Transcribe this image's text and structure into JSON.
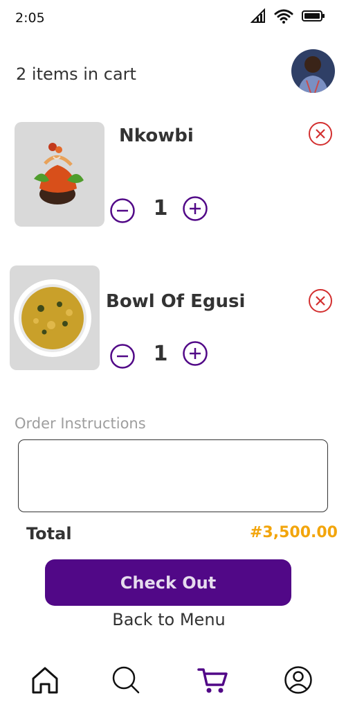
{
  "status_bar": {
    "time": "2:05",
    "icons": [
      "signal-icon",
      "wifi-icon",
      "battery-icon"
    ]
  },
  "header": {
    "cart_count_text": "2 items in cart",
    "avatar_icon": "user-avatar"
  },
  "cart": {
    "items": [
      {
        "name": "Nkowbi",
        "quantity": "1",
        "image_icon": "nkwobi-dish"
      },
      {
        "name": "Bowl Of Egusi",
        "quantity": "1",
        "image_icon": "egusi-bowl"
      }
    ]
  },
  "instructions": {
    "label": "Order Instructions",
    "value": ""
  },
  "summary": {
    "total_label": "Total",
    "total_value": "#3,500.00"
  },
  "actions": {
    "checkout_label": "Check Out",
    "back_label": "Back to Menu"
  },
  "nav": {
    "items": [
      "home-icon",
      "search-icon",
      "cart-icon",
      "profile-icon"
    ],
    "active": "cart-icon"
  },
  "colors": {
    "accent": "#510887",
    "price": "#f2a50c",
    "remove": "#d32f2f",
    "thumb_bg": "#d9d9d9"
  }
}
